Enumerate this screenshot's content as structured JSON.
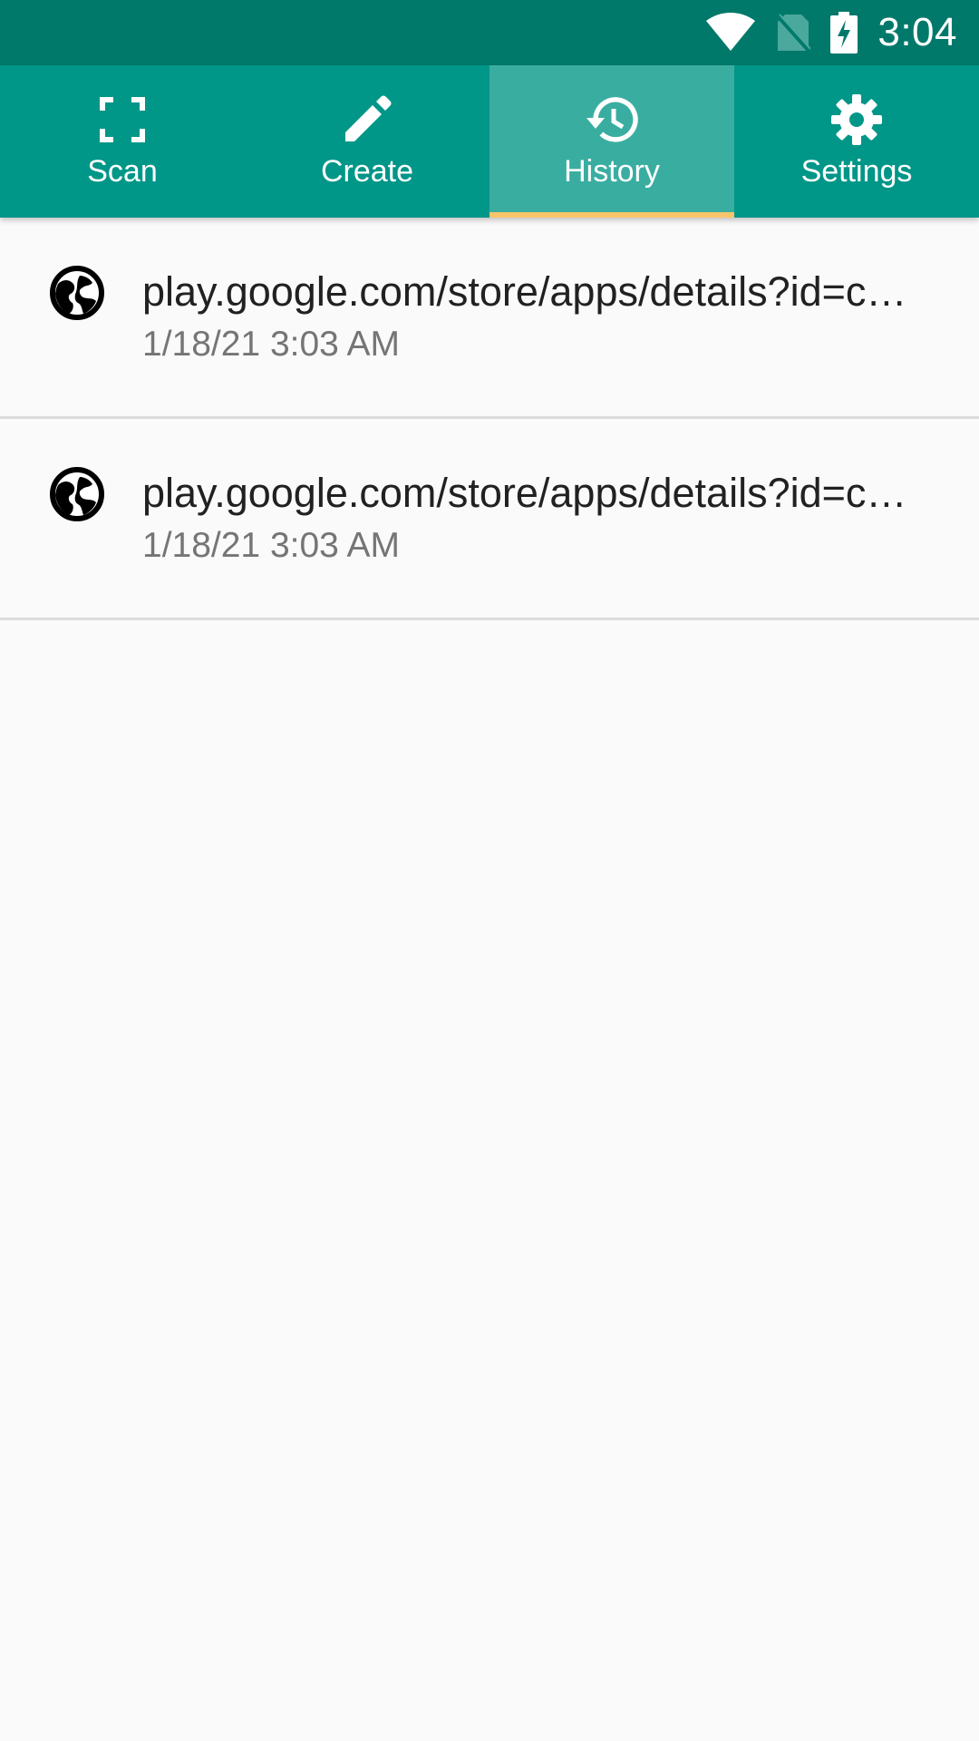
{
  "status_bar": {
    "time": "3:04",
    "icons": [
      "wifi-icon",
      "no-sim-icon",
      "battery-charging-icon"
    ],
    "background": "#00796b"
  },
  "tabs": [
    {
      "label": "Scan",
      "icon": "scan-icon",
      "active": false
    },
    {
      "label": "Create",
      "icon": "pencil-icon",
      "active": false
    },
    {
      "label": "History",
      "icon": "history-icon",
      "active": true
    },
    {
      "label": "Settings",
      "icon": "gear-icon",
      "active": false
    }
  ],
  "history": {
    "items": [
      {
        "icon": "globe-icon",
        "title": "play.google.com/store/apps/details?id=com.example.app",
        "date": "1/18/21 3:03 AM"
      },
      {
        "icon": "globe-icon",
        "title": "play.google.com/store/apps/details?id=com.example.app",
        "date": "1/18/21 3:03 AM"
      }
    ]
  },
  "colors": {
    "primary": "#009688",
    "primary_dark": "#00796b",
    "active_tab": "#3aada1",
    "indicator": "#f9c56a",
    "background": "#fafafa"
  }
}
